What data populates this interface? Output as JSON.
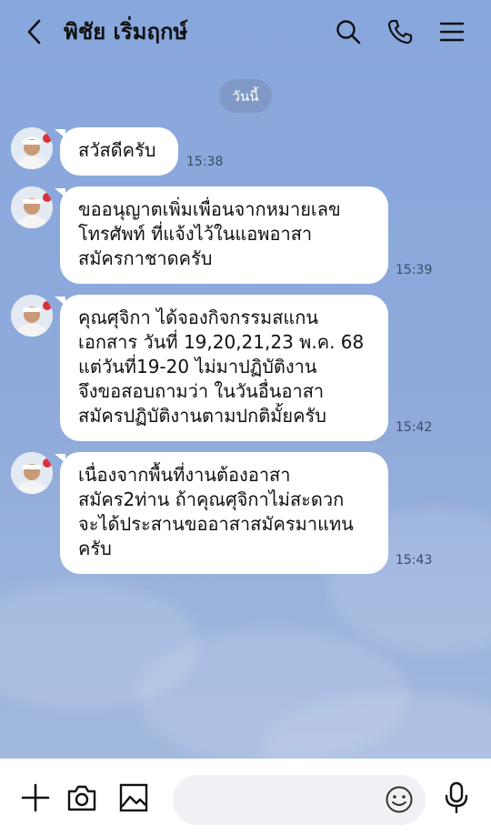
{
  "header": {
    "title": "พิชัย เริ่มฤกษ์",
    "back_icon": "chevron-left-icon",
    "search_icon": "search-icon",
    "call_icon": "phone-icon",
    "menu_icon": "menu-icon"
  },
  "date_label": "วันนี้",
  "messages": [
    {
      "lines": [
        "สวัสดีครับ"
      ],
      "time": "15:38"
    },
    {
      "lines": [
        "ขออนุญาตเพิ่มเพื่อนจากหมายเลข",
        "โทรศัพท์ ที่แจ้งไว้ในแอพอาสา",
        "สมัครกาชาดครับ"
      ],
      "time": "15:39"
    },
    {
      "lines": [
        "คุณศุจิกา ได้จองกิจกรรมสแกน",
        "เอกสาร วันที่ 19,20,21,23 พ.ค. 68",
        "แต่วันที่19-20 ไม่มาปฏิบัติงาน",
        "จึงขอสอบถามว่า ในวันอื่นอาสา",
        "สมัครปฏิบัติงานตามปกติมั้ยครับ"
      ],
      "time": "15:42"
    },
    {
      "lines": [
        "เนื่องจากพื้นที่งานต้องอาสา",
        "สมัคร2ท่าน ถ้าคุณศุจิกาไม่สะดวก",
        "จะได้ประสานขออาสาสมัครมาแทน",
        "ครับ"
      ],
      "time": "15:43"
    }
  ],
  "footer": {
    "add_icon": "plus-icon",
    "camera_icon": "camera-icon",
    "image_icon": "image-icon",
    "input_placeholder": "",
    "emoji_icon": "emoji-icon",
    "mic_icon": "microphone-icon"
  },
  "colors": {
    "chat_background": "#8ea9d8",
    "bubble": "#ffffff",
    "footer": "#ffffff"
  }
}
